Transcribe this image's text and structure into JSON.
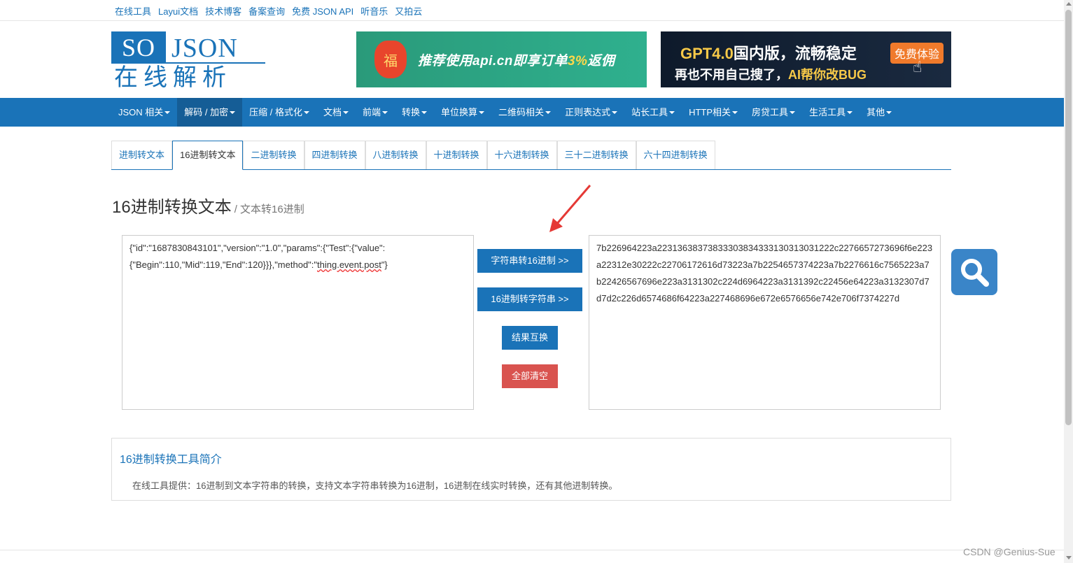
{
  "top_links": [
    "在线工具",
    "Layui文档",
    "技术博客",
    "备案查询",
    "免费 JSON API",
    "听音乐",
    "又拍云"
  ],
  "logo": {
    "so": "SO",
    "json": "JSON",
    "cn": "在线解析"
  },
  "banner1": {
    "bag": "福",
    "text_a": "推荐使用api.cn即享订单",
    "text_hl": "3%",
    "text_b": "返佣"
  },
  "banner2": {
    "l1_a": "GPT4.0",
    "l1_b": "国内版，流畅稳定",
    "button": "免费体验",
    "l2_a": "再也不用自己搜了，",
    "l2_hl": "AI帮你改BUG"
  },
  "nav": [
    {
      "label": "JSON 相关",
      "active": false
    },
    {
      "label": "解码 / 加密",
      "active": true
    },
    {
      "label": "压缩 / 格式化",
      "active": false
    },
    {
      "label": "文档",
      "active": false
    },
    {
      "label": "前端",
      "active": false
    },
    {
      "label": "转换",
      "active": false
    },
    {
      "label": "单位换算",
      "active": false
    },
    {
      "label": "二维码相关",
      "active": false
    },
    {
      "label": "正则表达式",
      "active": false
    },
    {
      "label": "站长工具",
      "active": false
    },
    {
      "label": "HTTP相关",
      "active": false
    },
    {
      "label": "房贷工具",
      "active": false
    },
    {
      "label": "生活工具",
      "active": false
    },
    {
      "label": "其他",
      "active": false
    }
  ],
  "tabs": [
    {
      "label": "进制转文本",
      "active": false
    },
    {
      "label": "16进制转文本",
      "active": true
    },
    {
      "label": "二进制转换",
      "active": false
    },
    {
      "label": "四进制转换",
      "active": false
    },
    {
      "label": "八进制转换",
      "active": false
    },
    {
      "label": "十进制转换",
      "active": false
    },
    {
      "label": "十六进制转换",
      "active": false
    },
    {
      "label": "三十二进制转换",
      "active": false
    },
    {
      "label": "六十四进制转换",
      "active": false
    }
  ],
  "heading": {
    "title": "16进制转换文本",
    "subtitle": "/ 文本转16进制"
  },
  "input_text": {
    "line1": "{\"id\":\"1687830843101\",\"version\":\"1.0\",\"params\":{\"Test\":{\"value\":",
    "line2_a": "{\"Begin\":110,\"Mid\":119,\"End\":120}}},\"method\":\"",
    "line2_squig": "thing.event.post",
    "line2_b": "\"}"
  },
  "output_text": "7b226964223a22313638373833303834333130313031222c2276657273696f6e223a22312e30222c22706172616d73223a7b2254657374223a7b2276616c7565223a7b22426567696e223a3131302c224d6964223a3131392c22456e64223a3132307d7d7d2c226d6574686f64223a227468696e672e6576656e742e706f7374227d",
  "buttons": {
    "to_hex": "字符串转16进制 >>",
    "to_str": "16进制转字符串 >>",
    "swap": "结果互换",
    "clear": "全部清空"
  },
  "info": {
    "title": "16进制转换工具简介",
    "desc": "在线工具提供：16进制到文本字符串的转换，支持文本字符串转换为16进制，16进制在线实时转换，还有其他进制转换。"
  },
  "watermark": "CSDN @Genius-Sue",
  "colors": {
    "primary": "#1a73b8",
    "danger": "#d9534f",
    "annotation": "#e53935"
  },
  "icons": {
    "search": "magnifier-icon",
    "arrow": "red-arrow-annotation"
  }
}
